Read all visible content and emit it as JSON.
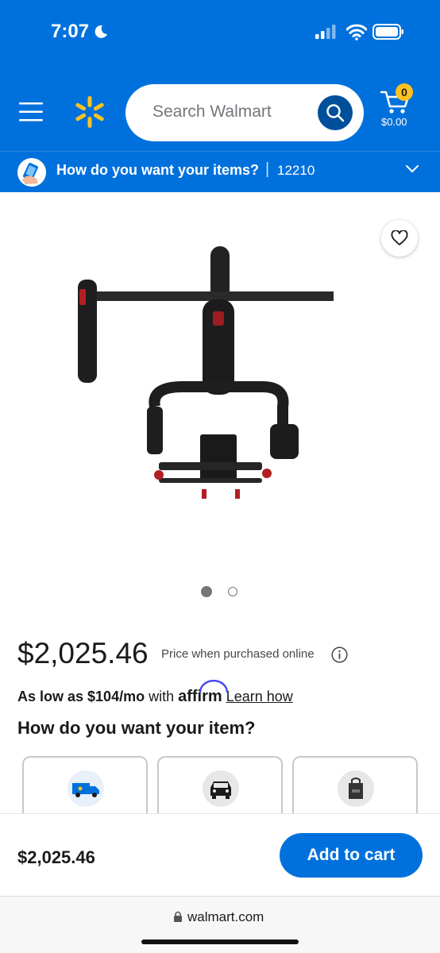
{
  "status_bar": {
    "time": "7:07"
  },
  "header": {
    "search_placeholder": "Search Walmart",
    "cart_count": "0",
    "cart_total": "$0.00"
  },
  "location": {
    "prompt": "How do you want your items?",
    "separator": "|",
    "zip": "12210"
  },
  "gallery": {
    "image_count": 2,
    "active_index": 0
  },
  "product": {
    "price": "$2,025.46",
    "price_note": "Price when purchased online"
  },
  "affirm": {
    "prefix": "As low as $104/mo",
    "middle": " with ",
    "brand": "affirm",
    "link": "Learn how"
  },
  "fulfillment": {
    "title": "How do you want your item?",
    "options": [
      {
        "icon": "shipping-truck-icon"
      },
      {
        "icon": "pickup-car-icon"
      },
      {
        "icon": "delivery-bag-icon"
      }
    ]
  },
  "bottom_bar": {
    "price": "$2,025.46",
    "add_to_cart": "Add to cart"
  },
  "browser": {
    "url": "walmart.com"
  },
  "colors": {
    "walmart_blue": "#0071dc",
    "dark_blue": "#004f9a",
    "spark_yellow": "#ffc220"
  }
}
